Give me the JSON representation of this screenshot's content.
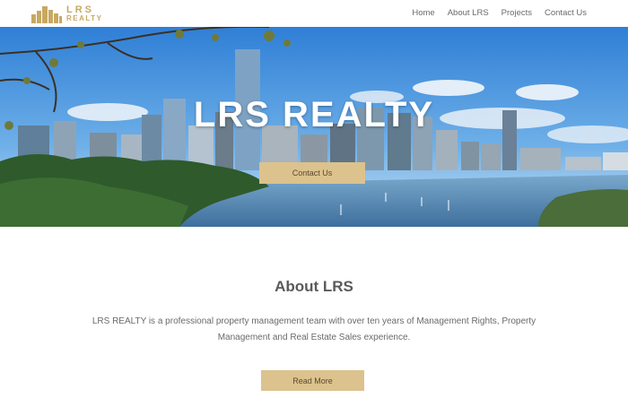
{
  "brand": {
    "line1": "LRS",
    "line2": "REALTY",
    "logo_icon": "building-logo-icon",
    "accent": "#c8a862"
  },
  "nav": {
    "items": [
      {
        "label": "Home"
      },
      {
        "label": "About LRS"
      },
      {
        "label": "Projects"
      },
      {
        "label": "Contact Us"
      }
    ]
  },
  "hero": {
    "title": "LRS REALTY",
    "button_label": "Contact Us"
  },
  "about": {
    "title": "About LRS",
    "line1": "LRS REALTY is a professional  property management team with over ten years of Management Rights, Property",
    "line2": "Management and Real Estate Sales experience.",
    "button_label": "Read More"
  },
  "colors": {
    "button": "#dcc28d",
    "sky": "#3f8fd8",
    "water": "#4a7fb0"
  }
}
